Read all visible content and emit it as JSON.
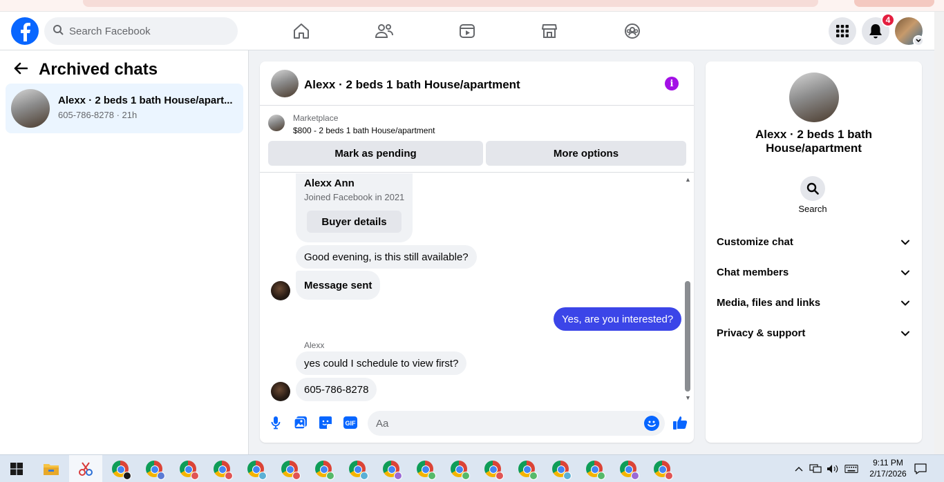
{
  "topbar": {
    "search_placeholder": "Search Facebook",
    "notification_count": "4",
    "nav_icons": [
      "home-icon",
      "friends-icon",
      "watch-icon",
      "marketplace-icon",
      "groups-icon"
    ]
  },
  "sidebar": {
    "title": "Archived chats",
    "chats": [
      {
        "name": "Alexx · 2 beds 1 bath House/apart...",
        "meta": "605-786-8278 · 21h"
      }
    ]
  },
  "chat": {
    "title": "Alexx · 2 beds 1 bath House/apartment",
    "marketplace": {
      "label": "Marketplace",
      "listing": "$800 - 2 beds 1 bath House/apartment",
      "mark_pending_label": "Mark as pending",
      "more_options_label": "More options"
    },
    "buyer": {
      "name": "Alexx Ann",
      "joined": "Joined Facebook in 2021",
      "details_label": "Buyer details"
    },
    "messages": [
      {
        "text": "Good evening, is this still available?"
      },
      {
        "text": "Message sent"
      },
      {
        "text": "Yes, are you interested?"
      },
      {
        "sender": "Alexx",
        "text": "yes could I schedule to view first?"
      },
      {
        "text": "605-786-8278"
      }
    ],
    "composer_placeholder": "Aa",
    "composer_icons": [
      "mic-icon",
      "photo-icon",
      "sticker-icon",
      "gif-icon",
      "emoji-icon",
      "thumbs-up-icon"
    ],
    "gif_label": "GIF"
  },
  "details_panel": {
    "name": "Alexx · 2 beds 1 bath House/apartment",
    "search_label": "Search",
    "sections": [
      "Customize chat",
      "Chat members",
      "Media, files and links",
      "Privacy & support"
    ]
  },
  "taskbar": {
    "time": "9:11 PM",
    "date": "2/17/2026"
  },
  "colors": {
    "facebook_blue": "#0866ff",
    "outgoing_bubble": "#3b45e8",
    "info_purple": "#a30fe6",
    "badge_red": "#e41e3f",
    "selected_chat": "#ebf5ff"
  }
}
